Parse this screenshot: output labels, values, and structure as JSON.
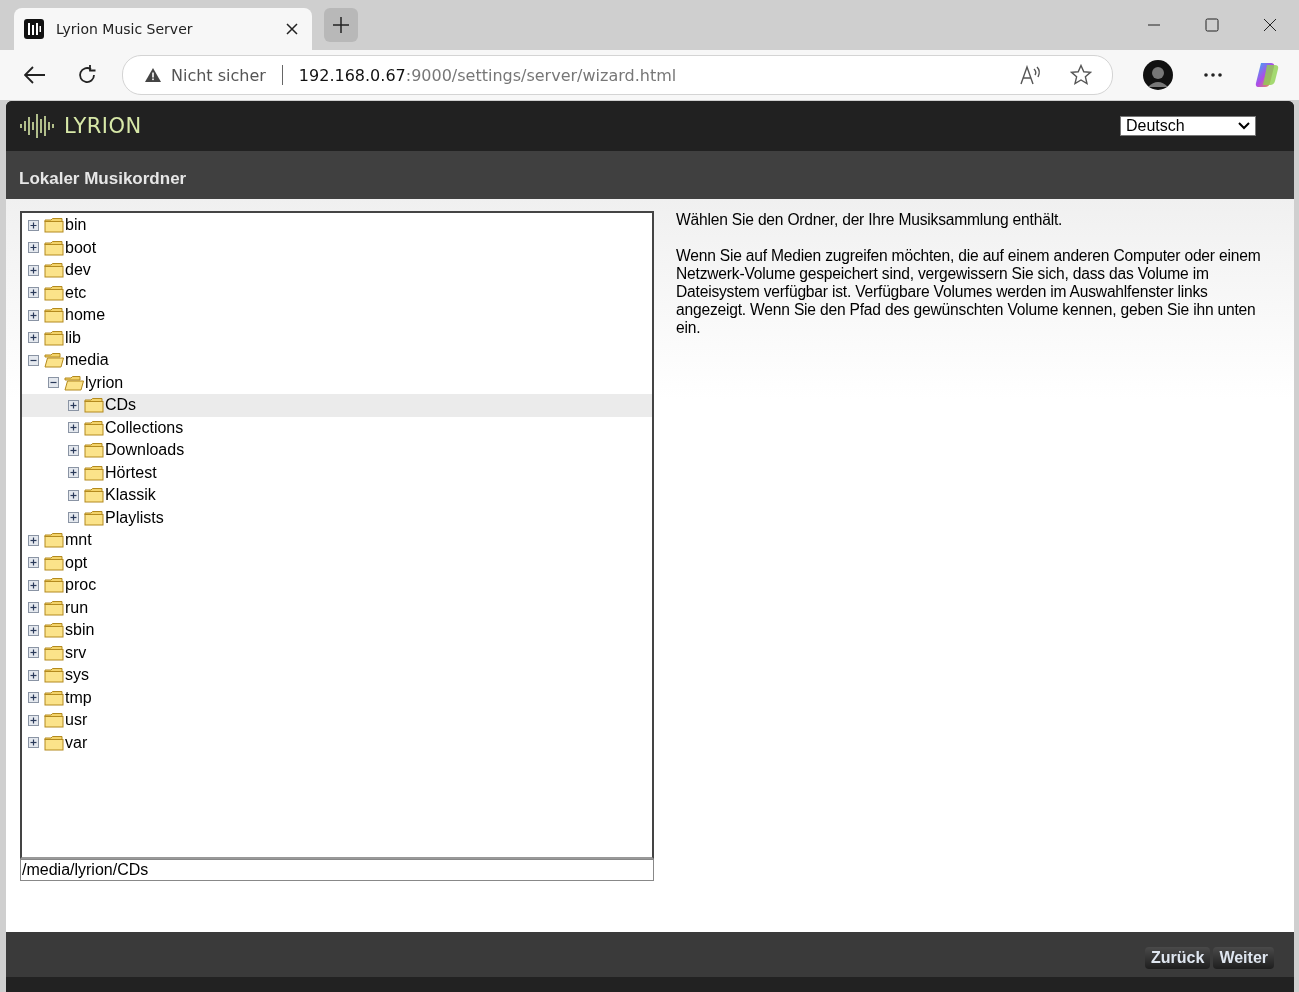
{
  "browser": {
    "tab_title": "Lyrion Music Server",
    "security_label": "Nicht sicher",
    "url_host": "192.168.0.67",
    "url_path": ":9000/settings/server/wizard.html"
  },
  "header": {
    "logo_text": "LYRION",
    "language": "Deutsch"
  },
  "page_title": "Lokaler Musikordner",
  "tree": [
    {
      "label": "bin",
      "expanded": false,
      "selected": false
    },
    {
      "label": "boot",
      "expanded": false,
      "selected": false
    },
    {
      "label": "dev",
      "expanded": false,
      "selected": false
    },
    {
      "label": "etc",
      "expanded": false,
      "selected": false
    },
    {
      "label": "home",
      "expanded": false,
      "selected": false
    },
    {
      "label": "lib",
      "expanded": false,
      "selected": false
    },
    {
      "label": "media",
      "expanded": true,
      "selected": false,
      "children": [
        {
          "label": "lyrion",
          "expanded": true,
          "selected": false,
          "children": [
            {
              "label": "CDs",
              "expanded": false,
              "selected": true
            },
            {
              "label": "Collections",
              "expanded": false,
              "selected": false
            },
            {
              "label": "Downloads",
              "expanded": false,
              "selected": false
            },
            {
              "label": "Hörtest",
              "expanded": false,
              "selected": false
            },
            {
              "label": "Klassik",
              "expanded": false,
              "selected": false
            },
            {
              "label": "Playlists",
              "expanded": false,
              "selected": false
            }
          ]
        }
      ]
    },
    {
      "label": "mnt",
      "expanded": false,
      "selected": false
    },
    {
      "label": "opt",
      "expanded": false,
      "selected": false
    },
    {
      "label": "proc",
      "expanded": false,
      "selected": false
    },
    {
      "label": "run",
      "expanded": false,
      "selected": false
    },
    {
      "label": "sbin",
      "expanded": false,
      "selected": false
    },
    {
      "label": "srv",
      "expanded": false,
      "selected": false
    },
    {
      "label": "sys",
      "expanded": false,
      "selected": false
    },
    {
      "label": "tmp",
      "expanded": false,
      "selected": false
    },
    {
      "label": "usr",
      "expanded": false,
      "selected": false
    },
    {
      "label": "var",
      "expanded": false,
      "selected": false
    }
  ],
  "path_value": "/media/lyrion/CDs",
  "description": [
    "Wählen Sie den Ordner, der Ihre Musiksammlung enthält.",
    "Wenn Sie auf Medien zugreifen möchten, die auf einem anderen Computer oder einem Netzwerk-Volume gespeichert sind, vergewissern Sie sich, dass das Volume im Dateisystem verfügbar ist. Verfügbare Volumes werden im Auswahlfenster links angezeigt. Wenn Sie den Pfad des gewünschten Volume kennen, geben Sie ihn unten ein."
  ],
  "buttons": [
    "Zurück",
    "Weiter"
  ]
}
